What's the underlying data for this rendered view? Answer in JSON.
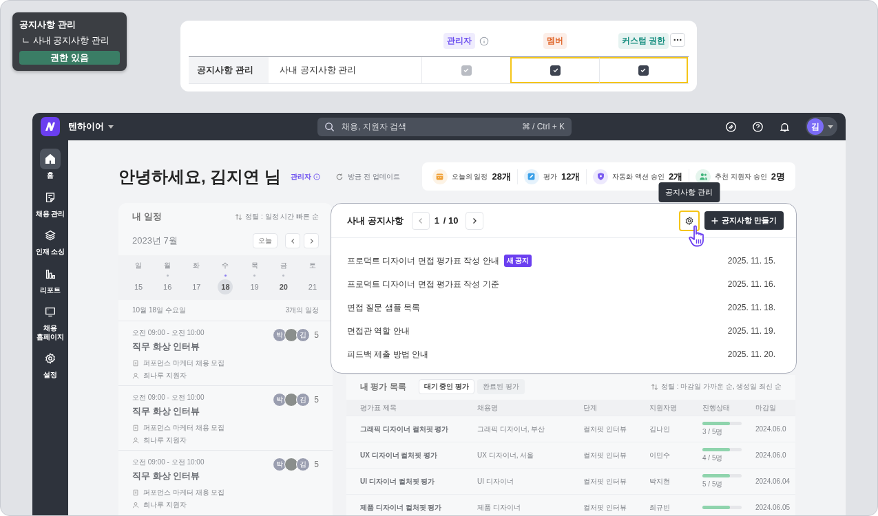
{
  "permission_tooltip": {
    "title": "공지사항 관리",
    "subtitle": "ㄴ 사내 공지사항 관리",
    "button": "권한 있음"
  },
  "permission_table": {
    "roles": [
      {
        "label": "관리자",
        "info": true,
        "color": "#6b4ef0"
      },
      {
        "label": "멤버",
        "info": false,
        "color": "#e0662a"
      },
      {
        "label": "커스텀 권한",
        "info": false,
        "color": "#178f80"
      }
    ],
    "row": {
      "group": "공지사항 관리",
      "name": "사내 공지사항 관리",
      "cells": [
        {
          "checked": true,
          "disabled": true,
          "highlighted": false
        },
        {
          "checked": true,
          "disabled": false,
          "highlighted": true
        },
        {
          "checked": true,
          "disabled": false,
          "highlighted": true
        }
      ]
    }
  },
  "app": {
    "workspace": "텐하이어",
    "search": {
      "placeholder": "채용, 지원자 검색",
      "shortcut": "⌘ / Ctrl + K"
    },
    "avatar": "김"
  },
  "sidebar": [
    {
      "label": "홈",
      "kind": "home",
      "selected": true
    },
    {
      "label": "채용 관리",
      "kind": "note",
      "selected": false
    },
    {
      "label": "인재 소싱",
      "kind": "layers",
      "selected": false
    },
    {
      "label": "리포트",
      "kind": "chart",
      "selected": false
    },
    {
      "label": "채용 홈페이지",
      "kind": "monitor",
      "selected": false
    },
    {
      "label": "설정",
      "kind": "gear",
      "selected": false
    }
  ],
  "greeting": {
    "title": "안녕하세요, 김지연 님",
    "role": "관리자",
    "updated": "방금 전 업데이트"
  },
  "stats": [
    {
      "label": "오늘의 일정",
      "value": "28개",
      "kind": "calendar",
      "color": "#f0a23a"
    },
    {
      "label": "평가",
      "value": "12개",
      "kind": "edit",
      "color": "#3aa0e8"
    },
    {
      "label": "자동화 액션 승인",
      "value": "2개",
      "kind": "shield",
      "color": "#7b5cf0"
    },
    {
      "label": "추천 지원자 승인",
      "value": "2명",
      "kind": "people",
      "color": "#3fb47a"
    }
  ],
  "schedule": {
    "title": "내 일정",
    "sort": "정렬 : 일정 시간 빠른 순",
    "month": "2023년 7월",
    "today_button": "오늘",
    "days": [
      {
        "weekday": "일",
        "date": "15",
        "event": false,
        "selected": false,
        "today": false
      },
      {
        "weekday": "월",
        "date": "16",
        "event": true,
        "selected": false,
        "today": false
      },
      {
        "weekday": "화",
        "date": "17",
        "event": false,
        "selected": false,
        "today": false
      },
      {
        "weekday": "수",
        "date": "18",
        "event": true,
        "selected": true,
        "today": false
      },
      {
        "weekday": "목",
        "date": "19",
        "event": true,
        "selected": false,
        "today": false
      },
      {
        "weekday": "금",
        "date": "20",
        "event": true,
        "selected": false,
        "today": true
      },
      {
        "weekday": "토",
        "date": "21",
        "event": false,
        "selected": false,
        "today": false
      }
    ],
    "day_label": "10월 18일 수요일",
    "count": "3개의 일정",
    "events": [
      {
        "time": "오전 09:00 - 오전 10:00",
        "title": "직무 화상 인터뷰",
        "job": "퍼포먼스 마케터 채용 모집",
        "applicant": "최나루 지원자",
        "attendees": [
          {
            "kind": "initial",
            "text": "박"
          },
          {
            "kind": "photo"
          },
          {
            "kind": "initial",
            "text": "김"
          }
        ],
        "more": "5"
      },
      {
        "time": "오전 09:00 - 오전 10:00",
        "title": "직무 화상 인터뷰",
        "job": "퍼포먼스 마케터 채용 모집",
        "applicant": "최나루 지원자",
        "attendees": [
          {
            "kind": "initial",
            "text": "박"
          },
          {
            "kind": "photo"
          },
          {
            "kind": "initial",
            "text": "김"
          }
        ],
        "more": "5"
      },
      {
        "time": "오전 09:00 - 오전 10:00",
        "title": "직무 화상 인터뷰",
        "job": "퍼포먼스 마케터 채용 모집",
        "applicant": "최나루 지원자",
        "attendees": [
          {
            "kind": "initial",
            "text": "박"
          },
          {
            "kind": "photo"
          },
          {
            "kind": "initial",
            "text": "김"
          }
        ],
        "more": "5"
      }
    ]
  },
  "notices": {
    "title": "사내 공지사항",
    "page": "1",
    "total": "/ 10",
    "tooltip": "공지사항 관리",
    "create_button": "공지사항 만들기",
    "items": [
      {
        "title": "프로덕트 디자이너 면접 평가표 작성 안내",
        "badge": "새 공지",
        "date": "2025. 11. 15."
      },
      {
        "title": "프로덕트 디자이너 면접 평가표 작성 기준",
        "date": "2025. 11. 16."
      },
      {
        "title": "면접 질문 샘플 목록",
        "date": "2025. 11. 18."
      },
      {
        "title": "면접관 역할 안내",
        "date": "2025. 11. 19."
      },
      {
        "title": "피드백 제출 방법 안내",
        "date": "2025. 11. 20."
      }
    ]
  },
  "evaluations": {
    "title": "내 평가 목록",
    "tabs": [
      {
        "label": "대기 중인 평가",
        "selected": true
      },
      {
        "label": "완료된 평가",
        "selected": false
      }
    ],
    "sort": "정렬 : 마감일 가까운 순, 생성일 최신 순",
    "columns": [
      "평가표 제목",
      "채용명",
      "단계",
      "지원자명",
      "진행상태",
      "마감일"
    ],
    "rows": [
      {
        "title": "그래픽 디자이너 컬처핏 평가",
        "job": "그래픽 디자이너, 부산",
        "stage": "컬처핏 인터뷰",
        "applicant": "김나인",
        "level": 0.7,
        "progress": "3 / 5명",
        "due": "2024.06.0"
      },
      {
        "title": "UX 디자이너 컬처핏 평가",
        "job": "UX 디자이너, 서울",
        "stage": "컬처핏 인터뷰",
        "applicant": "이민수",
        "level": 0.7,
        "progress": "4 / 5명",
        "due": "2024.06.0"
      },
      {
        "title": "UI 디자이너 컬처핏 평가",
        "job": "UI 디자이너",
        "stage": "컬처핏 인터뷰",
        "applicant": "박지현",
        "level": 0.7,
        "progress": "5 / 5명",
        "due": "2024.06.04"
      },
      {
        "title": "제품 디자이너 컬처핏 평가",
        "job": "제품 디자이너",
        "stage": "컬처핏 인터뷰",
        "applicant": "최규빈",
        "level": 0.7,
        "due": "2024.06.05"
      }
    ]
  }
}
